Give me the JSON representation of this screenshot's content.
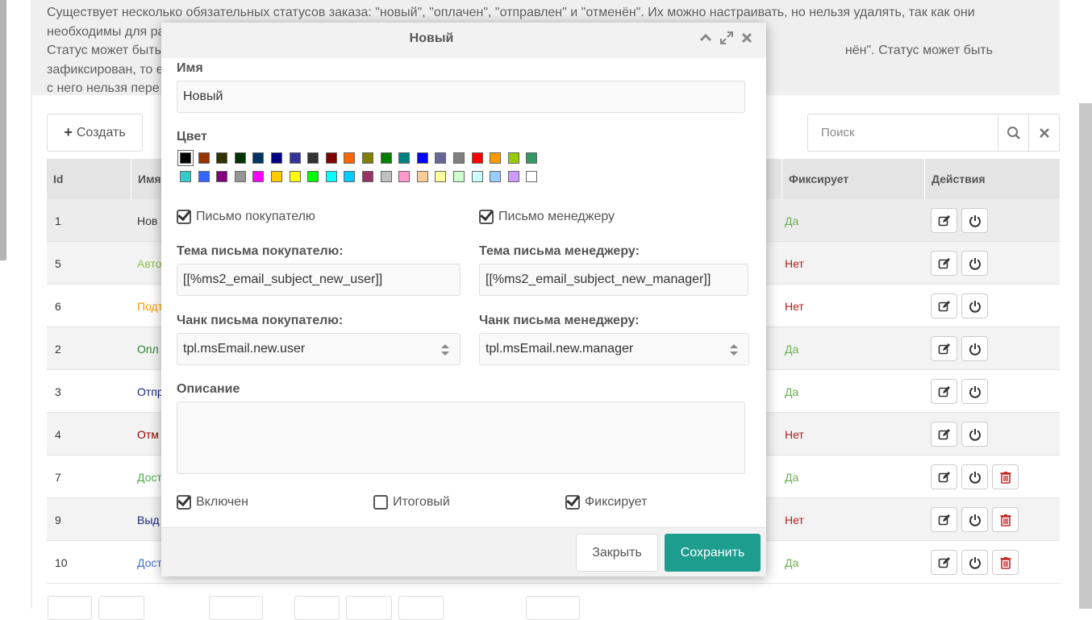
{
  "intro": {
    "line1": "Существует несколько обязательных статусов заказа: \"новый\", \"оплачен\", \"отправлен\" и \"отменён\". Их можно настраивать, но нельзя удалять, так как они",
    "line2": "необходимы для ра",
    "line3a": "Статус может быть",
    "line3b": "нён\". Статус может быть зафиксирован, то есть,",
    "line4": "с него нельзя пере"
  },
  "toolbar": {
    "create_label": "Создать",
    "search_placeholder": "Поиск"
  },
  "table": {
    "headers": {
      "id": "Id",
      "name": "Имя",
      "fixes": "Фиксирует",
      "actions": "Действия"
    },
    "rows": [
      {
        "id": "1",
        "name": "Нов",
        "name_color": "#333333",
        "fixes": "Да",
        "fixes_color": "#6ab04c",
        "deletable": false
      },
      {
        "id": "5",
        "name": "Авто",
        "name_color": "#8bc34a",
        "fixes": "Нет",
        "fixes_color": "#b71c1c",
        "deletable": false
      },
      {
        "id": "6",
        "name": "Подт",
        "name_color": "#ff9800",
        "fixes": "Нет",
        "fixes_color": "#b71c1c",
        "deletable": false
      },
      {
        "id": "2",
        "name": "Опл",
        "name_color": "#2e7d32",
        "fixes": "Да",
        "fixes_color": "#6ab04c",
        "deletable": false
      },
      {
        "id": "3",
        "name": "Отпр",
        "name_color": "#1a237e",
        "fixes": "Да",
        "fixes_color": "#6ab04c",
        "deletable": false
      },
      {
        "id": "4",
        "name": "Отм",
        "name_color": "#8b0000",
        "fixes": "Нет",
        "fixes_color": "#b71c1c",
        "deletable": false
      },
      {
        "id": "7",
        "name": "Дост",
        "name_color": "#4caf50",
        "fixes": "Да",
        "fixes_color": "#6ab04c",
        "deletable": true
      },
      {
        "id": "9",
        "name": "Выд",
        "name_color": "#1a237e",
        "fixes": "Нет",
        "fixes_color": "#b71c1c",
        "deletable": true
      },
      {
        "id": "10",
        "name": "Дост",
        "name_color": "#3f6fe0",
        "fixes": "Да",
        "fixes_color": "#6ab04c",
        "deletable": true
      }
    ]
  },
  "modal": {
    "title": "Новый",
    "name_label": "Имя",
    "name_value": "Новый",
    "color_label": "Цвет",
    "colors_row1": [
      "#000000",
      "#993300",
      "#333300",
      "#003300",
      "#003366",
      "#000080",
      "#333399",
      "#333333",
      "#800000",
      "#ff6600",
      "#808000",
      "#008000",
      "#008080",
      "#0000ff",
      "#666699",
      "#808080",
      "#ff0000",
      "#ff9900",
      "#99cc00",
      "#339966"
    ],
    "colors_row2": [
      "#33cccc",
      "#3366ff",
      "#800080",
      "#969696",
      "#ff00ff",
      "#ffcc00",
      "#ffff00",
      "#00ff00",
      "#00ffff",
      "#00ccff",
      "#993366",
      "#c0c0c0",
      "#ff99cc",
      "#ffcc99",
      "#ffff99",
      "#ccffcc",
      "#ccffff",
      "#99ccff",
      "#cc99ff",
      "#ffffff"
    ],
    "email_user_label": "Письмо покупателю",
    "email_manager_label": "Письмо менеджеру",
    "subject_user_label": "Тема письма покупателю:",
    "subject_user_value": "[[%ms2_email_subject_new_user]]",
    "subject_manager_label": "Тема письма менеджеру:",
    "subject_manager_value": "[[%ms2_email_subject_new_manager]]",
    "chunk_user_label": "Чанк письма покупателю:",
    "chunk_user_value": "tpl.msEmail.new.user",
    "chunk_manager_label": "Чанк письма менеджеру:",
    "chunk_manager_value": "tpl.msEmail.new.manager",
    "description_label": "Описание",
    "description_value": "",
    "active_label": "Включен",
    "final_label": "Итоговый",
    "fixed_label": "Фиксирует",
    "close_label": "Закрыть",
    "save_label": "Сохранить"
  }
}
